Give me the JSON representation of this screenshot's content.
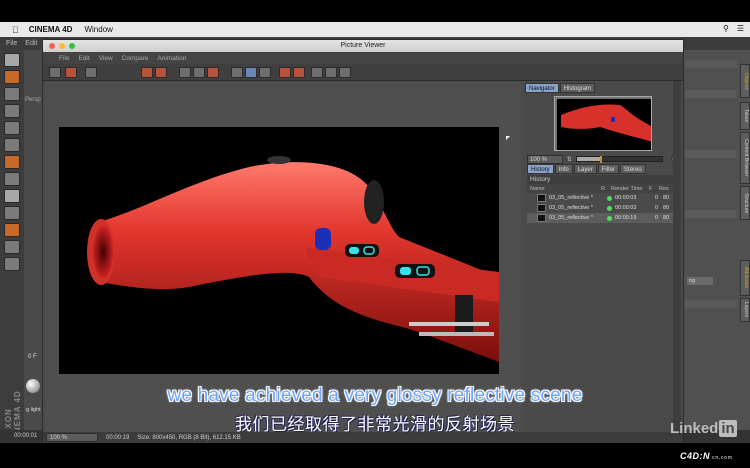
{
  "menubar": {
    "app_name": "CINEMA 4D",
    "menu_window": "Window"
  },
  "c4d": {
    "menu": [
      "File",
      "Edit"
    ],
    "left_labels": {
      "persp": "Persp",
      "frame": "0 F",
      "light": "g light"
    },
    "brand": "MAXON CINEMA 4D",
    "timeline_left": "00:00:01",
    "attr_field": "ng"
  },
  "picture_viewer": {
    "title": "Picture Viewer",
    "menu": [
      "File",
      "Edit",
      "View",
      "Compare",
      "Animation"
    ],
    "side_tabs": [
      "Navigator",
      "Histogram"
    ],
    "zoom_value": "100 %",
    "zoom_slider_fraction": 0.27,
    "lower_tabs": [
      "History",
      "Info",
      "Layer",
      "Filter",
      "Stereo"
    ],
    "history_title": "History",
    "history_columns": {
      "name": "Name",
      "r": "R",
      "render_time": "Render Time",
      "f": "F",
      "res": "Res"
    },
    "history_rows": [
      {
        "name": "03_05_reflective *",
        "render_time": "00:00:03",
        "f": "0",
        "res": "80"
      },
      {
        "name": "03_05_reflective *",
        "render_time": "00:00:03",
        "f": "0",
        "res": "80"
      },
      {
        "name": "03_05_reflective *",
        "render_time": "00:00:19",
        "f": "0",
        "res": "80"
      }
    ],
    "status": {
      "zoom": "100 %",
      "time": "00:00:19",
      "size": "Size: 800x450, RGB (8 Bit), 612.15 KB"
    }
  },
  "right_panel_tabs": [
    "Objects",
    "Takes",
    "Content Browser",
    "Structure",
    "Attributes",
    "Layers"
  ],
  "subtitles": {
    "english": "we have achieved a very glossy reflective scene",
    "chinese": "我们已经取得了非常光滑的反射场景"
  },
  "branding": {
    "linkedin_word": "Linked",
    "linkedin_in": "in",
    "watermark": "C4D:N",
    "watermark_small": "cn.com"
  },
  "colors": {
    "dryer_red": "#d8302a",
    "subtitle_blue": "#6ba4ff",
    "accent_orange": "#d48a2a",
    "led_cyan": "#38e0e8"
  }
}
